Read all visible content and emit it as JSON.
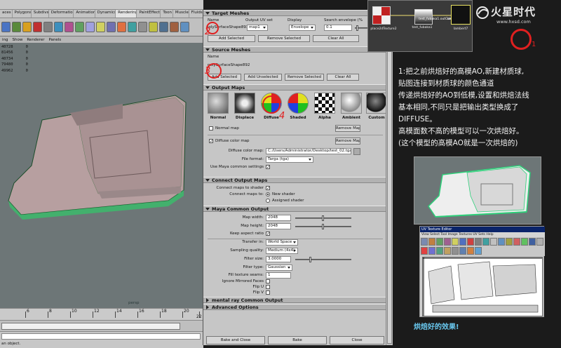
{
  "maya": {
    "shelf_tabs": [
      "aces",
      "Polygons",
      "Subdivs",
      "Deformation",
      "Animation",
      "Dynamics",
      "Rendering",
      "PaintEffects",
      "Toon",
      "Muscle",
      "Fluids"
    ],
    "viewport_menu": [
      "ing",
      "Show",
      "Renderer",
      "Panels"
    ],
    "hud_rows": [
      {
        "label": "40728",
        "value": "0"
      },
      {
        "label": "81456",
        "value": "0"
      },
      {
        "label": "40734",
        "value": "0"
      },
      {
        "label": "79480",
        "value": "0"
      },
      {
        "label": "49962",
        "value": "0"
      }
    ],
    "camera_label": "persp",
    "timeline_labels": [
      "6",
      "8",
      "10",
      "12",
      "14",
      "16",
      "18",
      "20",
      "22"
    ],
    "status_text": "an object."
  },
  "bake": {
    "target_meshes": {
      "header": "Target Meshes",
      "col_name": "Name",
      "col_uv": "Output UV set",
      "col_display": "Display",
      "col_envelope": "Search envelope (%",
      "mesh_name": "polySurfaceShape893",
      "uv_set": "map1",
      "display": "Envelope",
      "envelope_value": "0.1",
      "add_selected": "Add Selected",
      "remove_selected": "Remove Selected",
      "clear_all": "Clear All"
    },
    "source_meshes": {
      "header": "Source Meshes",
      "col_name": "Name",
      "mesh_name": "polySurfaceShape892",
      "add_selected": "Add Selected",
      "add_unselected": "Add Unselected",
      "remove_selected": "Remove Selected",
      "clear_all": "Clear All"
    },
    "output_maps": {
      "header": "Output Maps",
      "maps": [
        "Normal",
        "Displace",
        "Diffuse",
        "Shaded",
        "Alpha",
        "Ambient",
        "Custom"
      ],
      "normal_map_label": "Normal map",
      "remove_map": "Remove Map",
      "diffuse_color_map_label": "Diffuse color map",
      "diffuse_path_label": "Diffuse color map:",
      "diffuse_path": "C:/Users/Administrator/Desktop/test_02.tga",
      "file_format_label": "File format:",
      "file_format": "Targa (tga)",
      "use_common_label": "Use Maya common settings"
    },
    "connect_output": {
      "header": "Connect Output Maps",
      "connect_label": "Connect maps to shader",
      "connect_to_label": "Connect maps to:",
      "new_shader": "New shader",
      "assigned_shader": "Assigned shader"
    },
    "common_output": {
      "header": "Maya Common Output",
      "map_width_label": "Map width:",
      "map_width": "2048",
      "map_height_label": "Map height:",
      "map_height": "2048",
      "keep_aspect_label": "Keep aspect ratio",
      "transfer_label": "Transfer in:",
      "transfer": "World Space",
      "sampling_label": "Sampling quality:",
      "sampling": "Medium (4x4)",
      "filter_size_label": "Filter size:",
      "filter_size": "3.0000",
      "filter_type_label": "Filter type:",
      "filter_type": "Gaussian",
      "fill_seams_label": "Fill texture seams:",
      "fill_seams": "1",
      "ignore_mirrored_label": "Ignore Mirrored Faces",
      "flip_u_label": "Flip U",
      "flip_v_label": "Flip V"
    },
    "mental_ray_header": "mental ray Common Output",
    "advanced_header": "Advanced Options",
    "bake_close": "Bake and Close",
    "bake": "Bake",
    "close": "Close"
  },
  "annotations": [
    "2",
    "3",
    "4",
    "1"
  ],
  "hypershade": {
    "nodes": [
      "place2dTexture2",
      "test_fubaka1",
      "test_fubaka1.outColor",
      "lambert7.color",
      "lambert7"
    ]
  },
  "logo": {
    "title": "火星时代",
    "url": "www.hxsd.com"
  },
  "caption_lines": [
    "1:把之前烘焙好的高模AO,新建材质球,",
    "贴图连接到材质球的颜色通道",
    "传递烘焙好的AO到低模,设置和烘焙法线",
    "基本相同,不同只是把输出类型换成了",
    "DIFFUSE。",
    "高模面数不高的模型可以一次烘焙好。",
    "(这个模型的高模AO就是一次烘焙的)"
  ],
  "uv_editor": {
    "title": "UV Texture Editor",
    "menu": "View  Select  Tool  Image  Textures  UV Sets  Help"
  },
  "result_caption": "烘焙好的效果!"
}
